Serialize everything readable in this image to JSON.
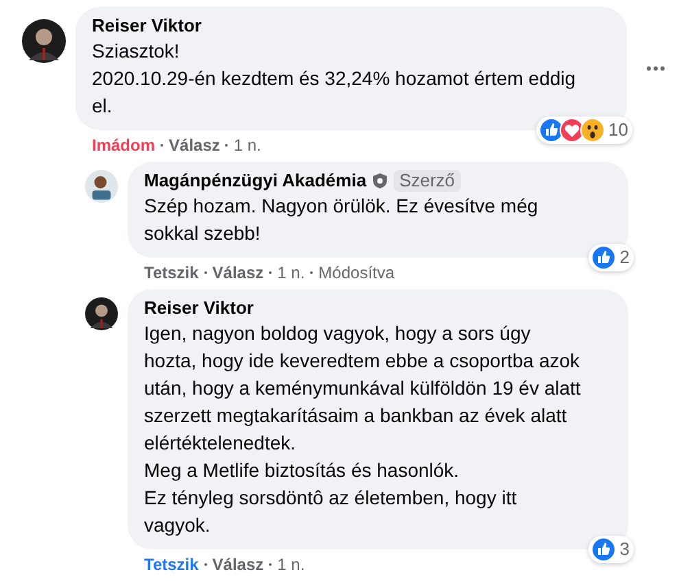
{
  "comments": [
    {
      "author": "Reiser Viktor",
      "avatar": {
        "kind": "man"
      },
      "lines": [
        "Sziasztok!",
        "2020.10.29-én kezdtem és 32,24% hozamot értem eddig",
        "el."
      ],
      "action": {
        "kind": "love",
        "label": "Imádom"
      },
      "reply_label": "Válasz",
      "time": "1 n.",
      "reactions": [
        {
          "kind": "like"
        },
        {
          "kind": "love"
        },
        {
          "kind": "wow"
        }
      ],
      "reaction_count": "10",
      "more_menu": true,
      "reply": false
    },
    {
      "author": "Magánpénzügyi Akadémia",
      "avatar": {
        "kind": "woman"
      },
      "author_badge": "Szerző",
      "lines": [
        "Szép hozam. Nagyon örülök. Ez évesítve még",
        "sokkal szebb!"
      ],
      "action": {
        "kind": "none",
        "label": "Tetszik"
      },
      "reply_label": "Válasz",
      "time": "1 n.",
      "edited": "Módosítva",
      "reactions": [
        {
          "kind": "like"
        }
      ],
      "reaction_count": "2",
      "more_menu": false,
      "reply": true
    },
    {
      "author": "Reiser Viktor",
      "avatar": {
        "kind": "man"
      },
      "lines": [
        "Igen, nagyon boldog vagyok, hogy a sors úgy",
        "hozta, hogy ide keveredtem ebbe a csoportba azok",
        "után, hogy a keménymunkával külföldön 19 év alatt",
        "szerzett megtakarításaim a bankban az évek alatt",
        "elértéktelenedtek.",
        "Meg a Metlife biztosítás és hasonlók.",
        "Ez tényleg sorsdöntô az életemben, hogy itt",
        "vagyok."
      ],
      "action": {
        "kind": "like",
        "label": "Tetszik"
      },
      "reply_label": "Válasz",
      "time": "1 n.",
      "reactions": [
        {
          "kind": "like"
        }
      ],
      "reaction_count": "3",
      "more_menu": false,
      "reply": true
    }
  ]
}
